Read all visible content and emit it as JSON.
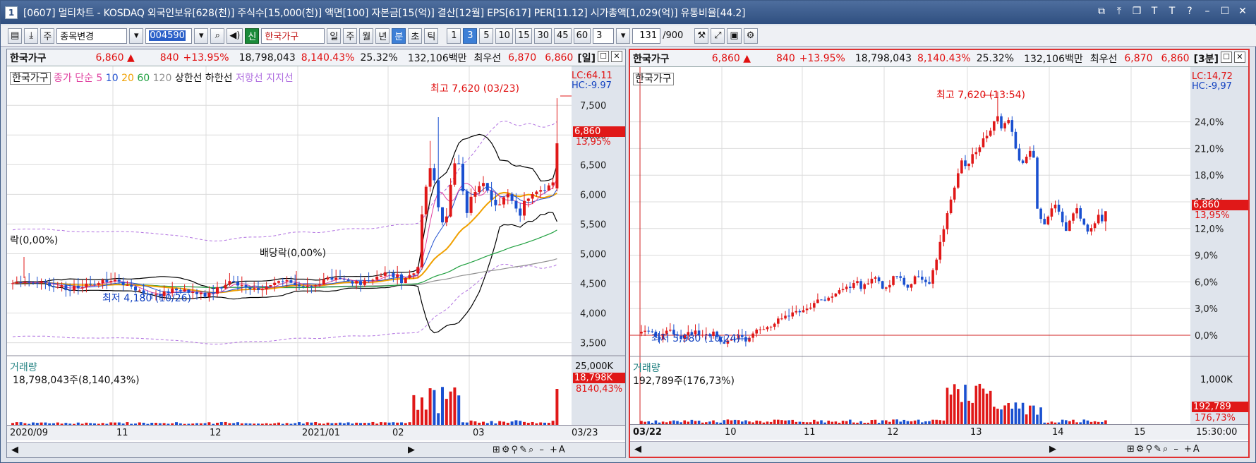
{
  "window": {
    "number": "1",
    "title": "[0607] 멀티차트 - KOSDAQ 외국인보유[628(천)] 주식수[15,000(천)] 액면[100] 자본금[15(억)] 결산[12월] EPS[617] PER[11.12] 시가총액[1,029(억)] 유통비율[44.2]",
    "controls": [
      "⧉",
      "⤒",
      "❐",
      "T",
      "T",
      "?",
      "–",
      "☐",
      "✕"
    ]
  },
  "toolbar": {
    "jong": "주",
    "change": "종목변경",
    "code": "004590",
    "shin": "신",
    "stock": "한국가구",
    "periods": [
      "일",
      "주",
      "월",
      "년",
      "분",
      "초",
      "틱"
    ],
    "active_period": "분",
    "minutes": [
      "1",
      "3",
      "5",
      "10",
      "15",
      "30",
      "45",
      "60"
    ],
    "active_minute": "3",
    "interval": "3",
    "count": "131",
    "count_max": "/900"
  },
  "left": {
    "name": "한국가구",
    "price": "6,860 ▲",
    "change": "840",
    "pct": "+13.95%",
    "volume": "18,798,043",
    "vol_pct": "8,140.43%",
    "turnover": "25.32%",
    "amount": "132,106백만",
    "best_label": "최우선",
    "best1": "6,870",
    "best2": "6,860",
    "period_tag": "[일]",
    "legend": {
      "name": "한국가구",
      "close": "종가 단순",
      "ma5": "5",
      "ma10": "10",
      "ma20": "20",
      "ma60": "60",
      "ma120": "120",
      "upper": "상한선",
      "lower": "하한선",
      "resist": "저항선",
      "support": "지지선"
    },
    "lc": "LC:64.11",
    "hc": "HC:-9.97",
    "high_note": "최고 7,620 (03/23)",
    "low_note": "최저 4,180 (10/26)",
    "div1": "락(0,00%)",
    "div2": "배당락(0,00%)",
    "price_tag": "6,860",
    "pct_tag": "13,95%",
    "ticks": [
      "7,500",
      "7,000",
      "6,500",
      "6,000",
      "5,500",
      "5,000",
      "4,500",
      "4,000",
      "3,500"
    ],
    "vol_label": "거래량",
    "vol_text": "18,798,043주(8,140,43%)",
    "vol_tick": "25,000K",
    "vol_tag": "18,798K",
    "vol_pct_tag": "8140,43%",
    "xlabels": [
      "2020/09",
      "11",
      "12",
      "2021/01",
      "02",
      "03"
    ],
    "x_last": "03/23"
  },
  "right": {
    "name": "한국가구",
    "price": "6,860 ▲",
    "change": "840",
    "pct": "+13.95%",
    "volume": "18,798,043",
    "vol_pct": "8,140.43%",
    "turnover": "25.32%",
    "amount": "132,106백만",
    "best_label": "최우선",
    "best1": "6,870",
    "best2": "6,860",
    "period_tag": "[3분]",
    "legend_name": "한국가구",
    "lc": "LC:14,72",
    "hc": "HC:-9,97",
    "high_note": "최고 7,620 (13:54)",
    "low_note": "최저 5,980 (10:24)",
    "price_tag": "6,860",
    "pct_tag": "13,95%",
    "ticks": [
      "24,0%",
      "21,0%",
      "18,0%",
      "15,0%",
      "12,0%",
      "9,0%",
      "6,0%",
      "3,0%",
      "0,0%"
    ],
    "vol_label": "거래량",
    "vol_text": "192,789주(176,73%)",
    "vol_tick": "1,000K",
    "vol_tag": "192,789",
    "vol_pct_tag": "176,73%",
    "xlabels": [
      "03/22",
      "10",
      "11",
      "12",
      "13",
      "14",
      "15"
    ],
    "x_last": "15:30:00"
  },
  "colors": {
    "up": "#e01818",
    "down": "#1a50d0",
    "ma5": "#e040a0",
    "ma10": "#2050d0",
    "ma20": "#f0a000",
    "ma60": "#20a040",
    "ma120": "#909090",
    "band": "#000000",
    "env": "#b070e0"
  },
  "icons": [
    "layout-icon",
    "download-icon",
    "search-icon",
    "speaker-icon",
    "screenshot-icon",
    "save-icon",
    "gear-icon"
  ]
}
